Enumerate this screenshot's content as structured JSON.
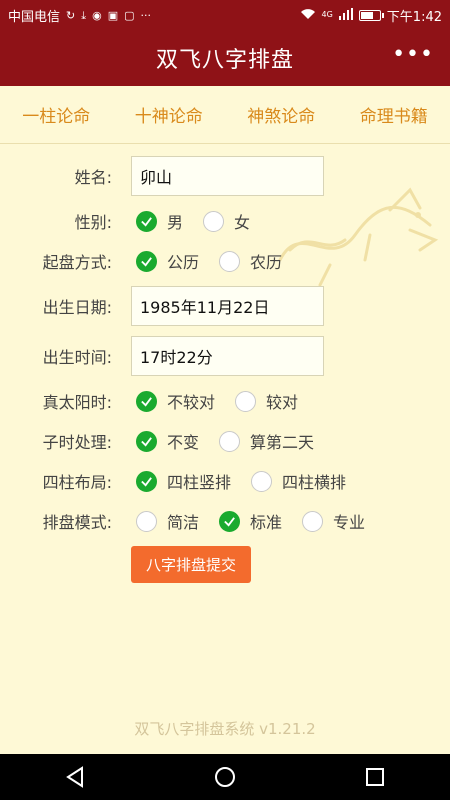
{
  "status_bar": {
    "carrier": "中国电信",
    "time": "下午1:42",
    "network": "4G"
  },
  "app_bar": {
    "title": "双飞八字排盘",
    "more": "•••"
  },
  "tabs": [
    {
      "label": "一柱论命"
    },
    {
      "label": "十神论命"
    },
    {
      "label": "神煞论命"
    },
    {
      "label": "命理书籍"
    }
  ],
  "form": {
    "name": {
      "label": "姓名:",
      "value": "卯山"
    },
    "gender": {
      "label": "性别:",
      "options": [
        {
          "text": "男",
          "checked": true
        },
        {
          "text": "女",
          "checked": false
        }
      ]
    },
    "calendar": {
      "label": "起盘方式:",
      "options": [
        {
          "text": "公历",
          "checked": true
        },
        {
          "text": "农历",
          "checked": false
        }
      ]
    },
    "birth_date": {
      "label": "出生日期:",
      "value": "1985年11月22日"
    },
    "birth_time": {
      "label": "出生时间:",
      "value": "17时22分"
    },
    "solar_time": {
      "label": "真太阳时:",
      "options": [
        {
          "text": "不较对",
          "checked": true
        },
        {
          "text": "较对",
          "checked": false
        }
      ]
    },
    "zi_hour": {
      "label": "子时处理:",
      "options": [
        {
          "text": "不变",
          "checked": true
        },
        {
          "text": "算第二天",
          "checked": false
        }
      ]
    },
    "pillar_layout": {
      "label": "四柱布局:",
      "options": [
        {
          "text": "四柱竖排",
          "checked": true
        },
        {
          "text": "四柱横排",
          "checked": false
        }
      ]
    },
    "mode": {
      "label": "排盘模式:",
      "options": [
        {
          "text": "简洁",
          "checked": false
        },
        {
          "text": "标准",
          "checked": true
        },
        {
          "text": "专业",
          "checked": false
        }
      ]
    }
  },
  "submit_label": "八字排盘提交",
  "footer": "双飞八字排盘系统 v1.21.2",
  "colors": {
    "header": "#8f1217",
    "tab_text": "#d98a1c",
    "check_green": "#1aaa2f",
    "submit": "#f36b2d",
    "background": "#fef9d6"
  }
}
